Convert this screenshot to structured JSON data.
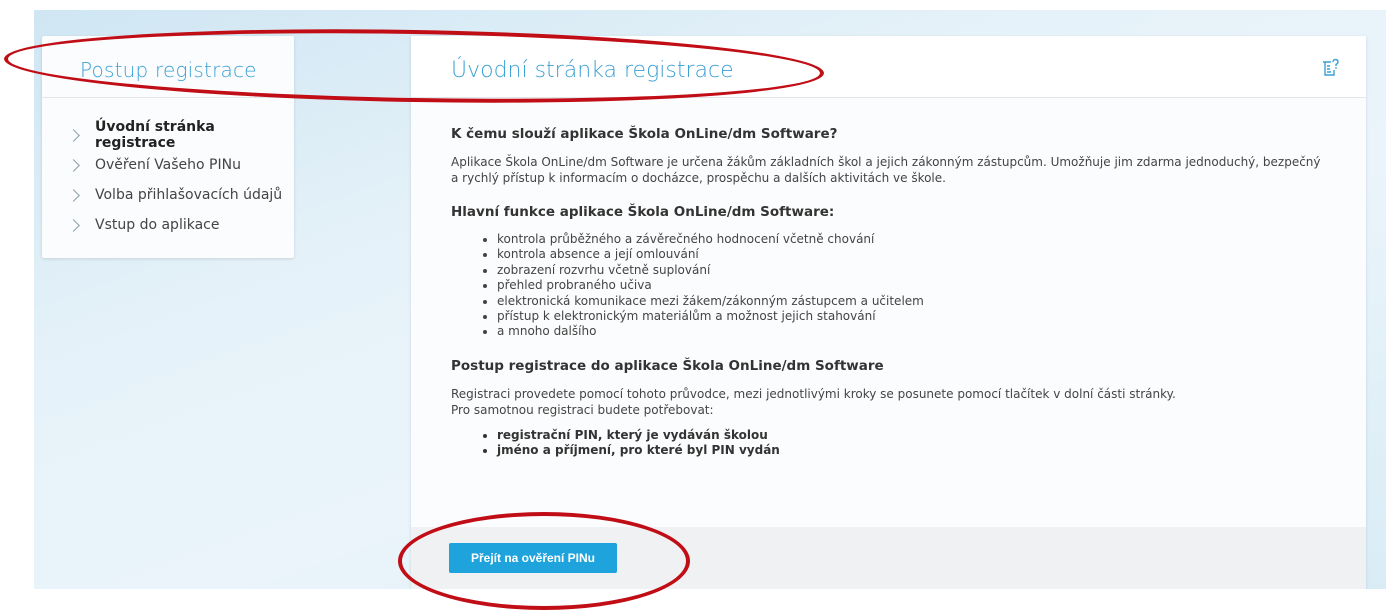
{
  "sidebar": {
    "title": "Postup registrace",
    "items": [
      {
        "label": "Úvodní stránka registrace"
      },
      {
        "label": "Ověření Vašeho PINu"
      },
      {
        "label": "Volba přihlašovacích údajů"
      },
      {
        "label": "Vstup do aplikace"
      }
    ]
  },
  "main": {
    "title": "Úvodní stránka registrace",
    "help_icon": "help-icon",
    "section1": {
      "heading": "K čemu slouží aplikace Škola OnLine/dm Software?",
      "text": "Aplikace Škola OnLine/dm Software je určena žákům základních škol a jejich zákonným zástupcům. Umožňuje jim zdarma jednoduchý, bezpečný a rychlý přístup k informacím o docházce, prospěchu a dalších aktivitách ve škole."
    },
    "section2": {
      "heading": "Hlavní funkce aplikace Škola OnLine/dm Software:",
      "items": [
        "kontrola průběžného a závěrečného hodnocení včetně chování",
        "kontrola absence a její omlouvání",
        "zobrazení rozvrhu včetně suplování",
        "přehled probraného učiva",
        "elektronická komunikace mezi žákem/zákonným zástupcem a učitelem",
        "přístup k elektronickým materiálům a možnost jejich stahování",
        "a mnoho dalšího"
      ]
    },
    "section3": {
      "heading": "Postup registrace do aplikace Škola OnLine/dm Software",
      "text1": "Registraci provedete pomocí tohoto průvodce, mezi jednotlivými kroky se posunete pomocí tlačítek v dolní části stránky.",
      "text2": "Pro samotnou registraci budete potřebovat:",
      "items": [
        "registrační PIN, který je vydáván školou",
        "jméno a příjmení, pro které byl PIN vydán"
      ]
    },
    "next_button": "Přejít na ověření PINu"
  },
  "colors": {
    "accent": "#3aa0d4",
    "button": "#1fa3dc",
    "annotation": "#c00d16"
  }
}
